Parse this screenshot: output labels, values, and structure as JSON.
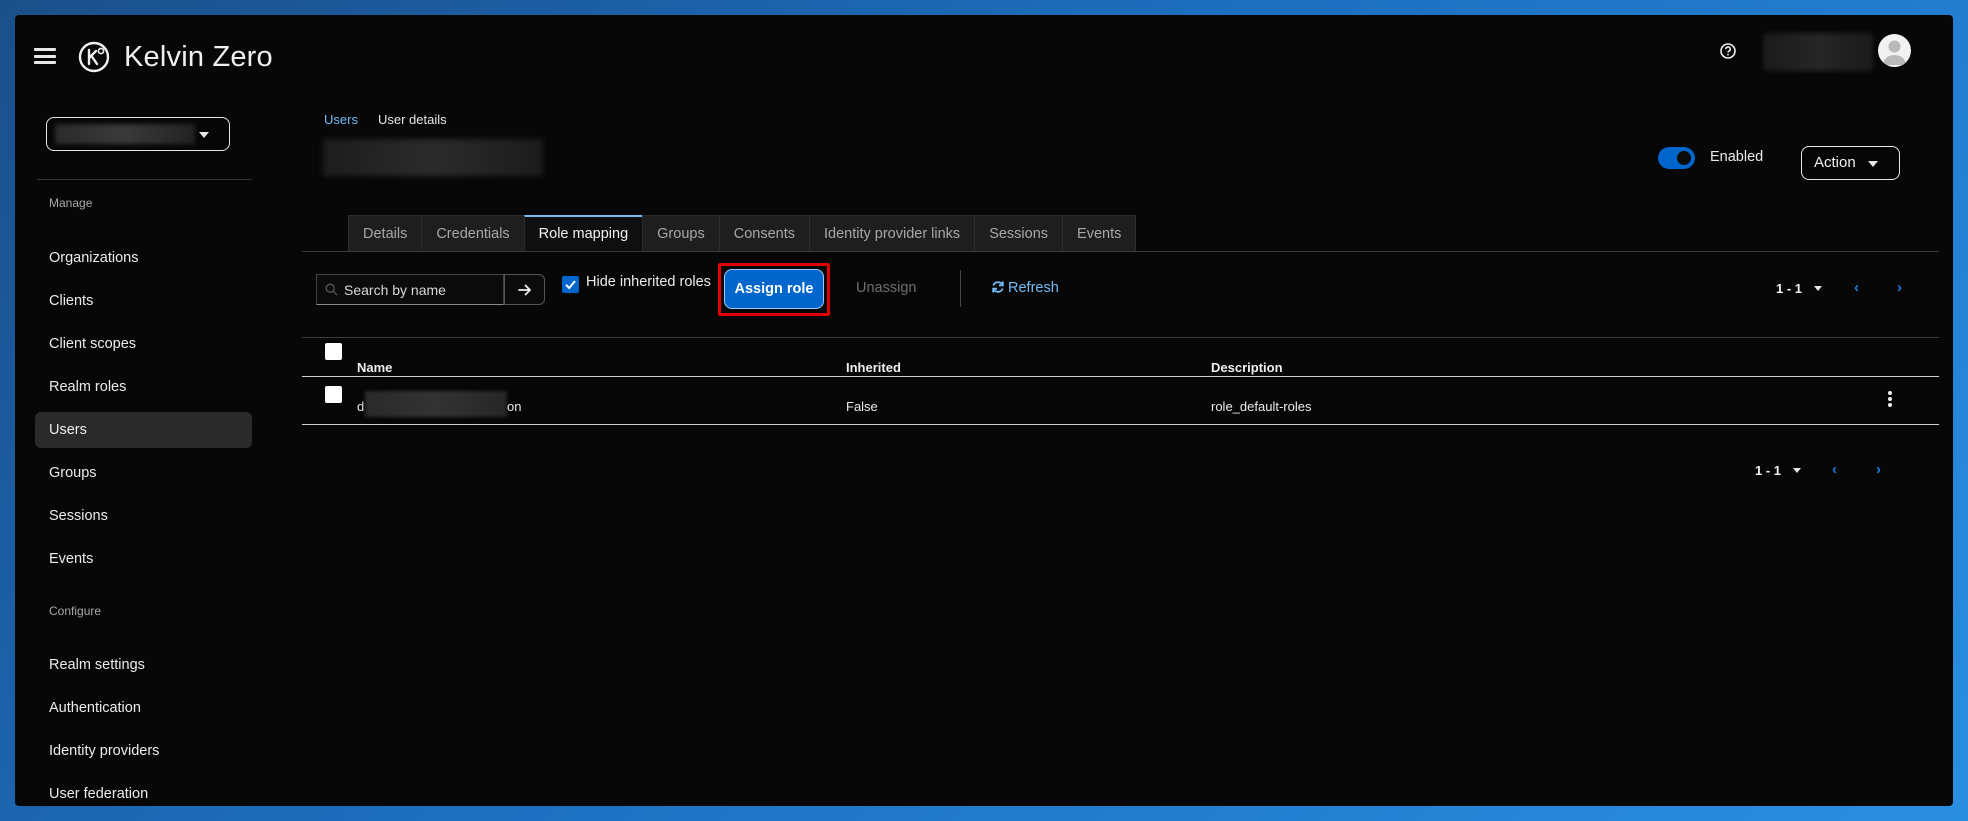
{
  "app": {
    "brand": "Kelvin Zero",
    "accent_color": "#0066cc",
    "link_color": "#73bcf7"
  },
  "sidebar": {
    "manage_heading": "Manage",
    "manage_items": [
      {
        "label": "Organizations"
      },
      {
        "label": "Clients"
      },
      {
        "label": "Client scopes"
      },
      {
        "label": "Realm roles"
      },
      {
        "label": "Users",
        "active": true
      },
      {
        "label": "Groups"
      },
      {
        "label": "Sessions"
      },
      {
        "label": "Events"
      }
    ],
    "configure_heading": "Configure",
    "configure_items": [
      {
        "label": "Realm settings"
      },
      {
        "label": "Authentication"
      },
      {
        "label": "Identity providers"
      },
      {
        "label": "User federation"
      }
    ]
  },
  "breadcrumb": {
    "parent": "Users",
    "current": "User details"
  },
  "header_controls": {
    "enabled_label": "Enabled",
    "action_label": "Action"
  },
  "tabs": [
    {
      "label": "Details"
    },
    {
      "label": "Credentials"
    },
    {
      "label": "Role mapping",
      "active": true
    },
    {
      "label": "Groups"
    },
    {
      "label": "Consents"
    },
    {
      "label": "Identity provider links"
    },
    {
      "label": "Sessions"
    },
    {
      "label": "Events"
    }
  ],
  "toolbar": {
    "search_placeholder": "Search by name",
    "hide_inherited_label": "Hide inherited roles",
    "assign_label": "Assign role",
    "unassign_label": "Unassign",
    "refresh_label": "Refresh",
    "pagination_top": "1 - 1"
  },
  "table": {
    "columns": [
      "Name",
      "Inherited",
      "Description"
    ],
    "rows": [
      {
        "name_prefix": "d",
        "name_suffix": "on",
        "inherited": "False",
        "description": "role_default-roles"
      }
    ]
  },
  "pagination_bottom": "1 - 1"
}
